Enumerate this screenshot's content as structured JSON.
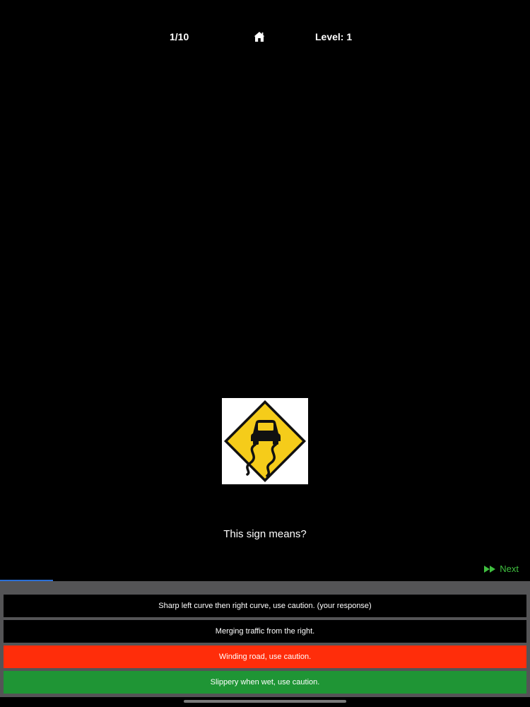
{
  "header": {
    "progress": "1/10",
    "home_icon": "home-icon",
    "level": "Level: 1"
  },
  "question": {
    "sign_icon": "slippery-when-wet-sign",
    "sign_colors": {
      "fill": "#f5cc1a",
      "border": "#111111",
      "background": "#ffffff"
    },
    "text": "This sign means?"
  },
  "next": {
    "icon": "fast-forward-icon",
    "label": "Next",
    "color": "#3fbf3f"
  },
  "quiz_progress": {
    "fraction": 0.1,
    "color": "#2a6fd6"
  },
  "answers": [
    {
      "label": "Sharp left curve then right curve, use caution. (your response)",
      "state": "default"
    },
    {
      "label": "Merging traffic from the right.",
      "state": "default"
    },
    {
      "label": "Winding road, use caution.",
      "state": "wrong"
    },
    {
      "label": "Slippery when wet, use caution.",
      "state": "correct"
    }
  ],
  "colors": {
    "wrong": "#ff2d0a",
    "correct": "#1f9535",
    "panel": "#545456"
  }
}
